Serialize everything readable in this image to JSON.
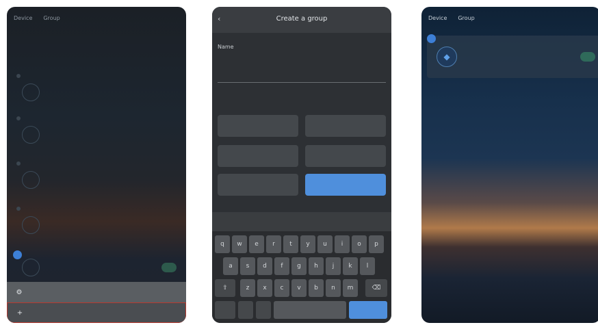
{
  "phone1": {
    "tabs": [
      "Device",
      "Group"
    ],
    "rows": [
      {
        "name": "",
        "sub": ""
      },
      {
        "name": "",
        "sub": ""
      },
      {
        "name": "",
        "sub": ""
      },
      {
        "name": "",
        "sub": ""
      },
      {
        "name": "",
        "sub": ""
      }
    ],
    "selected_row": {
      "name": "",
      "sub": ""
    },
    "menu": [
      {
        "icon": "gear-icon",
        "label": ""
      },
      {
        "icon": "plus-icon",
        "label": ""
      }
    ]
  },
  "phone2": {
    "title": "Create a group",
    "name_label": "Name",
    "name_value": "",
    "select_label": "",
    "chips": [
      {
        "label": "",
        "selected": false
      },
      {
        "label": "",
        "selected": false
      },
      {
        "label": "",
        "selected": false
      },
      {
        "label": "",
        "selected": false
      },
      {
        "label": "",
        "selected": false
      },
      {
        "label": "",
        "selected": true
      }
    ],
    "suggestions": [
      "",
      "",
      ""
    ],
    "keyboard": {
      "row1": [
        "q",
        "w",
        "e",
        "r",
        "t",
        "y",
        "u",
        "i",
        "o",
        "p"
      ],
      "row2": [
        "a",
        "s",
        "d",
        "f",
        "g",
        "h",
        "j",
        "k",
        "l"
      ],
      "row3": [
        "z",
        "x",
        "c",
        "v",
        "b",
        "n",
        "m"
      ]
    }
  },
  "phone3": {
    "tabs": [
      "Device",
      "Group"
    ],
    "card": {
      "name": "",
      "sub": ""
    }
  },
  "colors": {
    "accent": "#4f8fdc",
    "check": "#3d7fd6",
    "toggle_on": "#2f6a5a"
  }
}
